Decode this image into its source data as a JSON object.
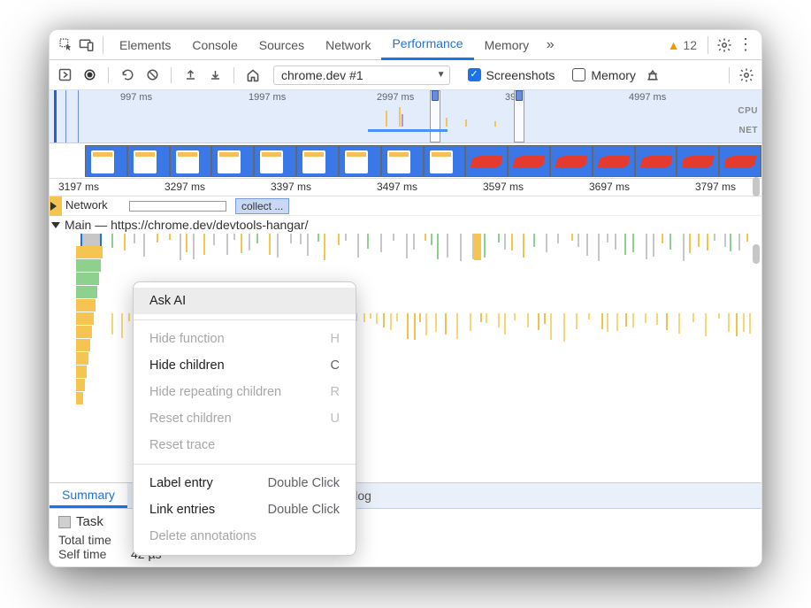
{
  "tabs": {
    "elements": "Elements",
    "console": "Console",
    "sources": "Sources",
    "network": "Network",
    "performance": "Performance",
    "memory": "Memory"
  },
  "warnings_count": "12",
  "toolbar": {
    "recording_select": "chrome.dev #1",
    "screenshots_label": "Screenshots",
    "memory_label": "Memory"
  },
  "overview": {
    "ticks": [
      "997 ms",
      "1997 ms",
      "2997 ms",
      "39",
      "4997 ms"
    ],
    "cpu_label": "CPU",
    "net_label": "NET"
  },
  "ruler": {
    "ticks": [
      "3197 ms",
      "3297 ms",
      "3397 ms",
      "3497 ms",
      "3597 ms",
      "3697 ms",
      "3797 ms"
    ]
  },
  "tracks": {
    "network_label": "Network",
    "collect_pill": "collect ...",
    "main_label": "Main — https://chrome.dev/devtools-hangar/"
  },
  "context_menu": {
    "ask_ai": "Ask AI",
    "hide_function": "Hide function",
    "hide_function_key": "H",
    "hide_children": "Hide children",
    "hide_children_key": "C",
    "hide_repeating": "Hide repeating children",
    "hide_repeating_key": "R",
    "reset_children": "Reset children",
    "reset_children_key": "U",
    "reset_trace": "Reset trace",
    "label_entry": "Label entry",
    "label_entry_hint": "Double Click",
    "link_entries": "Link entries",
    "link_entries_hint": "Double Click",
    "delete_annotations": "Delete annotations"
  },
  "bottom_tabs": {
    "summary": "Summary",
    "event_log_suffix": "ent log"
  },
  "details": {
    "task_label": "Task",
    "total_time_label": "Total time",
    "self_time_label": "Self time",
    "self_time_value": "42 µs"
  }
}
